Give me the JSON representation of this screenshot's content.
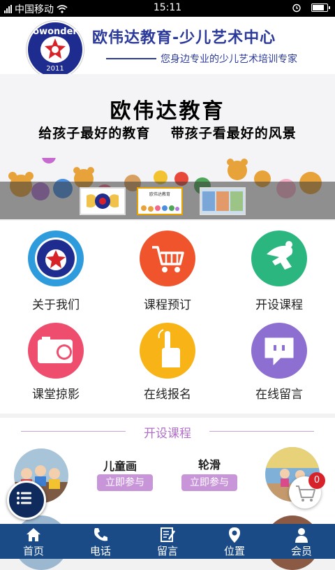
{
  "status_bar": {
    "carrier": "中国移动",
    "time": "15:11"
  },
  "header": {
    "logo_text": "owonder",
    "logo_year": "2011",
    "title": "欧伟达教育-少儿艺术中心",
    "subtitle": "您身边专业的少儿艺术培训专家"
  },
  "banner": {
    "title": "欧伟达教育",
    "slogan": "给孩子最好的教育 带孩子看最好的风景",
    "thumbnails": [
      {
        "label": ""
      },
      {
        "label": "欧伟达教育"
      },
      {
        "label": ""
      }
    ],
    "active_index": 1
  },
  "features": [
    {
      "label": "关于我们",
      "icon": "about-logo-icon",
      "color": "#2e9bdc"
    },
    {
      "label": "课程预订",
      "icon": "cart-icon",
      "color": "#f0542d"
    },
    {
      "label": "开设课程",
      "icon": "skater-icon",
      "color": "#2cb67f"
    },
    {
      "label": "课堂掠影",
      "icon": "camera-icon",
      "color": "#ee4d6e"
    },
    {
      "label": "在线报名",
      "icon": "tap-icon",
      "color": "#f8b417"
    },
    {
      "label": "在线留言",
      "icon": "chat-icon",
      "color": "#8c6fd1"
    }
  ],
  "courses_section": {
    "title": "开设课程",
    "courses": [
      {
        "name": "儿童画",
        "action": "立即参与"
      },
      {
        "name": "轮滑",
        "action": "立即参与"
      }
    ]
  },
  "cart": {
    "count": "0"
  },
  "tabbar": [
    {
      "label": "首页",
      "icon": "home-icon"
    },
    {
      "label": "电话",
      "icon": "phone-icon"
    },
    {
      "label": "留言",
      "icon": "message-icon"
    },
    {
      "label": "位置",
      "icon": "location-icon"
    },
    {
      "label": "会员",
      "icon": "member-icon"
    }
  ],
  "colors": {
    "primary": "#1a4b86",
    "accent": "#c896d8",
    "badge": "#d8222a"
  }
}
